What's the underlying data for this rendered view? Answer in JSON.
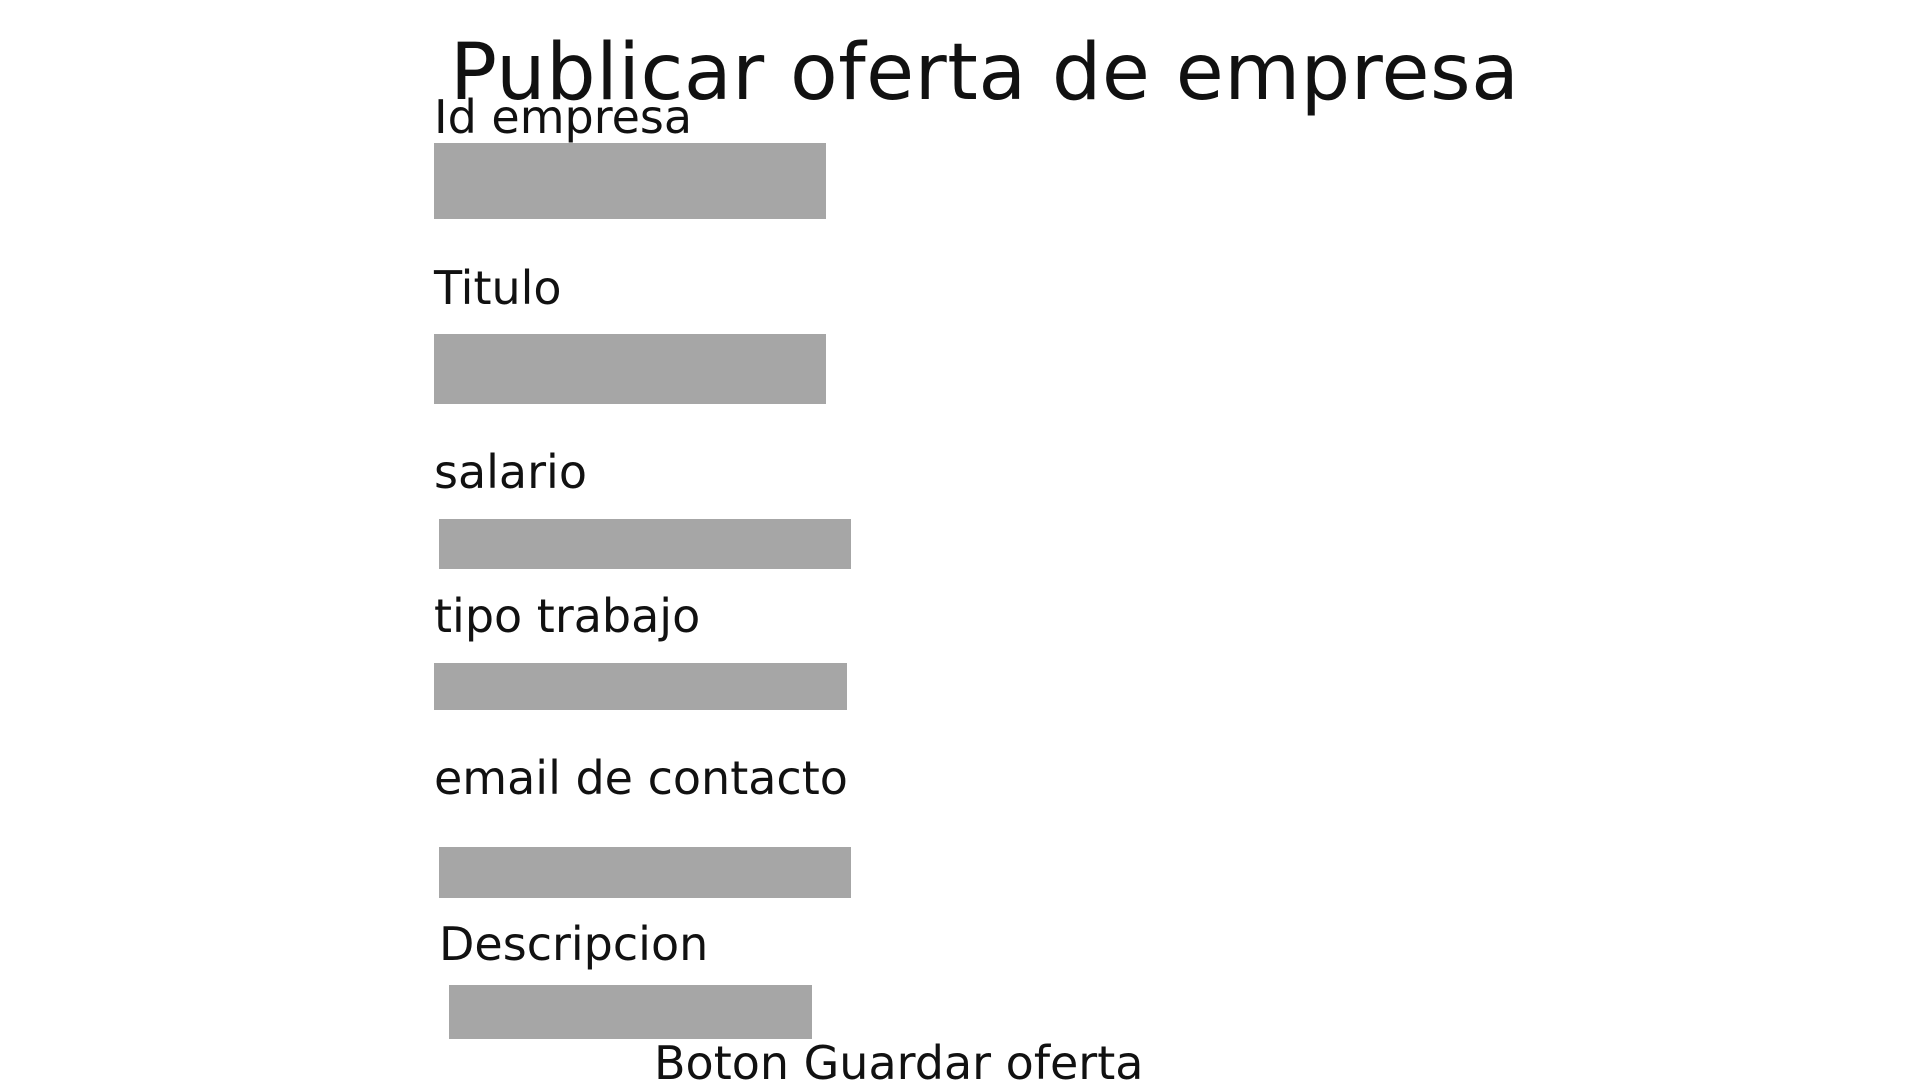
{
  "page": {
    "title": "Publicar oferta de empresa"
  },
  "form": {
    "fields": [
      {
        "label": "Id empresa",
        "value": "",
        "placeholder": ""
      },
      {
        "label": "Titulo",
        "value": "",
        "placeholder": ""
      },
      {
        "label": "salario",
        "value": "",
        "placeholder": ""
      },
      {
        "label": "tipo trabajo",
        "value": "",
        "placeholder": ""
      },
      {
        "label": "email de contacto",
        "value": "",
        "placeholder": ""
      },
      {
        "label": "Descripcion",
        "value": "",
        "placeholder": ""
      }
    ],
    "save_label": "Boton Guardar oferta"
  },
  "colors": {
    "field_background": "#a6a6a6",
    "page_background": "#ffffff",
    "text": "#111111"
  }
}
